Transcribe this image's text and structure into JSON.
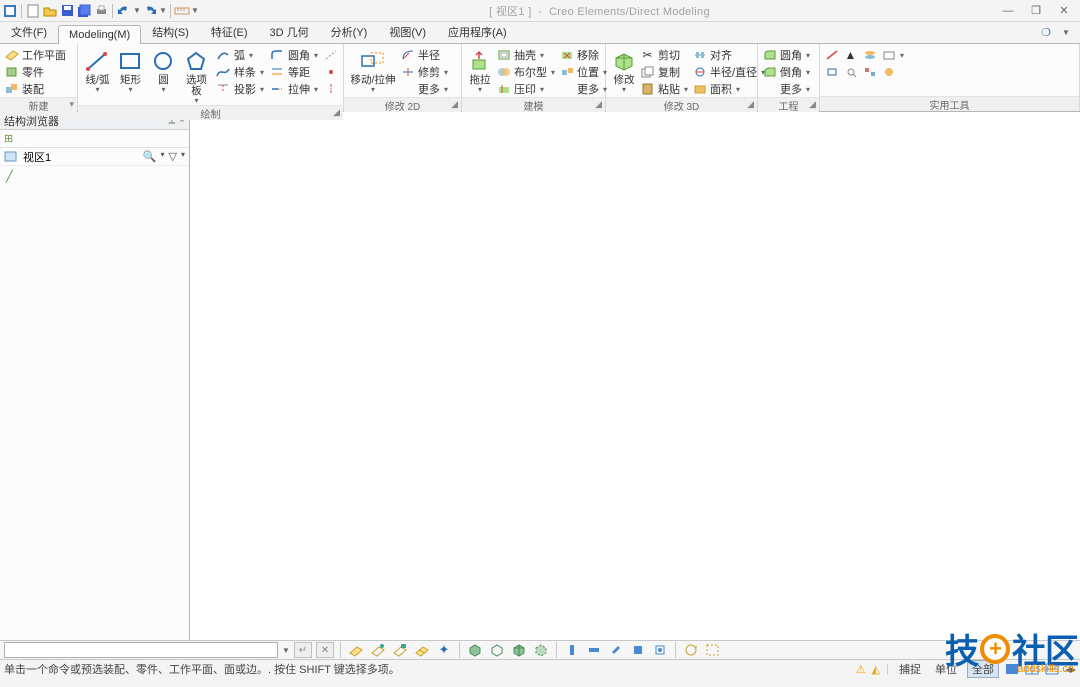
{
  "title": {
    "doc": "[ 视区1 ]",
    "app": "Creo Elements/Direct Modeling"
  },
  "tabs": [
    {
      "label": "文件(F)"
    },
    {
      "label": "Modeling(M)",
      "active": true
    },
    {
      "label": "结构(S)"
    },
    {
      "label": "特征(E)"
    },
    {
      "label": "3D 几何"
    },
    {
      "label": "分析(Y)"
    },
    {
      "label": "视图(V)"
    },
    {
      "label": "应用程序(A)"
    }
  ],
  "ribbon": {
    "new": {
      "title": "新建",
      "items": [
        {
          "label": "工作平面"
        },
        {
          "label": "零件"
        },
        {
          "label": "装配"
        }
      ]
    },
    "draw": {
      "title": "绘制",
      "big": [
        {
          "label": "线/弧"
        },
        {
          "label": "矩形"
        },
        {
          "label": "圆"
        },
        {
          "label": "选项板"
        }
      ],
      "stack": [
        {
          "label": "弧"
        },
        {
          "label": "样条"
        },
        {
          "label": "投影"
        }
      ],
      "stack2": [
        {
          "label": "圆角"
        },
        {
          "label": "等距"
        },
        {
          "label": "拉伸"
        }
      ],
      "stack3_icons": [
        "axis",
        "point",
        "hole"
      ]
    },
    "mod2d": {
      "title": "修改 2D",
      "big": [
        {
          "label": "移动/拉伸"
        }
      ],
      "stack": [
        {
          "label": "半径"
        },
        {
          "label": "修剪"
        },
        {
          "label": "更多"
        }
      ]
    },
    "model": {
      "title": "建模",
      "big": [
        {
          "label": "拖拉"
        }
      ],
      "stack": [
        {
          "label": "抽壳"
        },
        {
          "label": "布尔型"
        },
        {
          "label": "压印"
        }
      ],
      "stack2": [
        {
          "label": "移除"
        },
        {
          "label": "位置"
        },
        {
          "label": "更多"
        }
      ]
    },
    "mod3d": {
      "title": "修改 3D",
      "big": [
        {
          "label": "修改"
        }
      ],
      "stack": [
        {
          "label": "剪切"
        },
        {
          "label": "复制"
        },
        {
          "label": "粘贴"
        }
      ],
      "stack2": [
        {
          "label": "对齐"
        },
        {
          "label": "半径/直径"
        },
        {
          "label": "面积"
        }
      ]
    },
    "eng": {
      "title": "工程",
      "stack": [
        {
          "label": "圆角"
        },
        {
          "label": "倒角"
        },
        {
          "label": "更多"
        }
      ]
    },
    "util": {
      "title": "实用工具"
    }
  },
  "sidebar": {
    "title": "结构浏览器",
    "viewport_label": "视区1"
  },
  "commandbar": {
    "input_value": ""
  },
  "statusbar": {
    "hint": "单击一个命令或预选装配、零件、工作平面、面或边。. 按住 SHIFT 键选择多项。",
    "snap": "捕捉",
    "unit": "单位",
    "all": "全部"
  },
  "watermark": {
    "l": "技",
    "r": "社区",
    "url": "addskills.cn"
  }
}
